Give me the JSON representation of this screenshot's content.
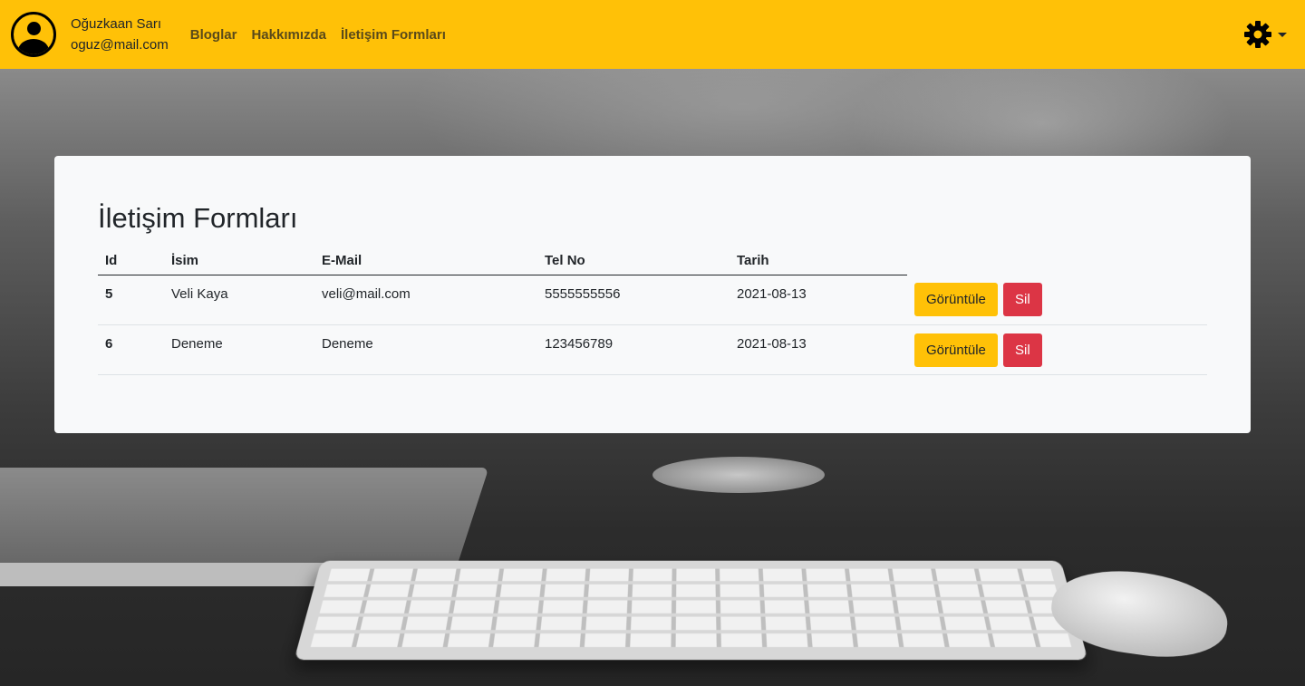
{
  "navbar": {
    "user_name": "Oğuzkaan Sarı",
    "user_email": "oguz@mail.com",
    "links": [
      "Bloglar",
      "Hakkımızda",
      "İletişim Formları"
    ],
    "settings_icon": "gear-icon"
  },
  "page": {
    "title": "İletişim Formları"
  },
  "table": {
    "headers": [
      "Id",
      "İsim",
      "E-Mail",
      "Tel No",
      "Tarih"
    ],
    "rows": [
      {
        "id": "5",
        "name": "Veli Kaya",
        "email": "veli@mail.com",
        "phone": "5555555556",
        "date": "2021-08-13",
        "view_label": "Görüntüle",
        "delete_label": "Sil"
      },
      {
        "id": "6",
        "name": "Deneme",
        "email": "Deneme",
        "phone": "123456789",
        "date": "2021-08-13",
        "view_label": "Görüntüle",
        "delete_label": "Sil"
      }
    ]
  },
  "colors": {
    "navbar": "#ffc107",
    "view_button": "#ffc107",
    "delete_button": "#dc3545"
  }
}
